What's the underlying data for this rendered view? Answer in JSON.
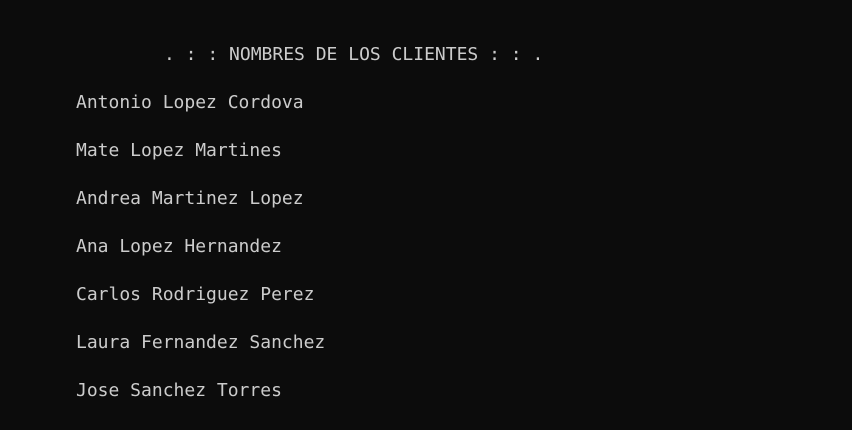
{
  "console": {
    "title": ". : : NOMBRES DE LOS CLIENTES : : .",
    "clients": [
      "Antonio Lopez Cordova",
      "Mate Lopez Martines",
      "Andrea Martinez Lopez",
      "Ana Lopez Hernandez",
      "Carlos Rodriguez Perez",
      "Laura Fernandez Sanchez",
      "Jose Sanchez Torres"
    ]
  }
}
